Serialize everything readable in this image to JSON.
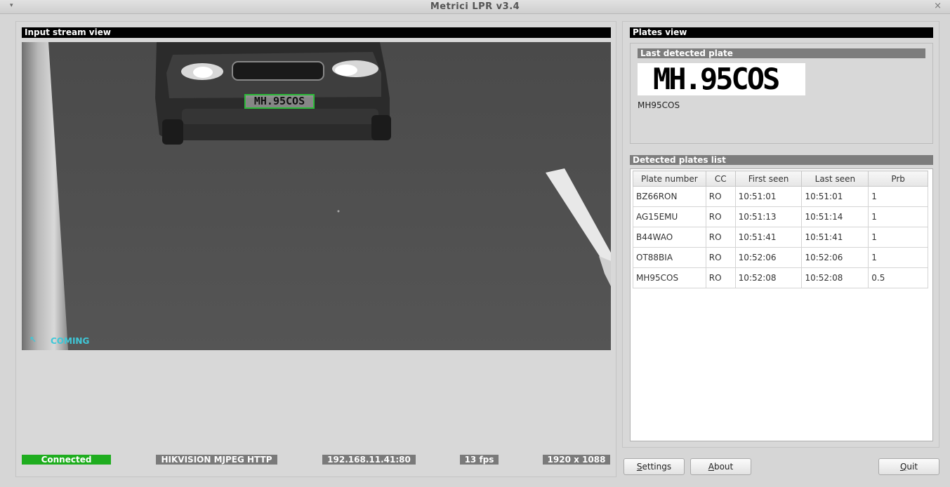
{
  "window": {
    "title": "Metrici LPR v3.4",
    "menu_glyph": "▾",
    "close_glyph": "×"
  },
  "input_stream": {
    "header": "Input stream view",
    "overlay_text": "COMING",
    "overlay_plate": "MH.95COS"
  },
  "status_bar": {
    "connection": "Connected",
    "source": "HIKVISION MJPEG HTTP",
    "address": "192.168.11.41:80",
    "fps": "13 fps",
    "resolution": "1920 x 1088",
    "colors": {
      "connected": "#1fad1f",
      "info": "#7a7a7a"
    }
  },
  "plates_view": {
    "header": "Plates view",
    "last_detected": {
      "header": "Last detected plate",
      "plate_image_text": "MH.95COS",
      "plate_text": "MH95COS"
    },
    "list": {
      "header": "Detected plates list",
      "columns": [
        "Plate number",
        "CC",
        "First seen",
        "Last seen",
        "Prb"
      ],
      "rows": [
        [
          "BZ66RON",
          "RO",
          "10:51:01",
          "10:51:01",
          "1"
        ],
        [
          "AG15EMU",
          "RO",
          "10:51:13",
          "10:51:14",
          "1"
        ],
        [
          "B44WAO",
          "RO",
          "10:51:41",
          "10:51:41",
          "1"
        ],
        [
          "OT88BIA",
          "RO",
          "10:52:06",
          "10:52:06",
          "1"
        ],
        [
          "MH95COS",
          "RO",
          "10:52:08",
          "10:52:08",
          "0.5"
        ]
      ]
    }
  },
  "buttons": {
    "settings": {
      "first": "S",
      "rest": "ettings"
    },
    "about": {
      "first": "A",
      "rest": "bout"
    },
    "quit": {
      "first": "Q",
      "rest": "uit"
    }
  }
}
